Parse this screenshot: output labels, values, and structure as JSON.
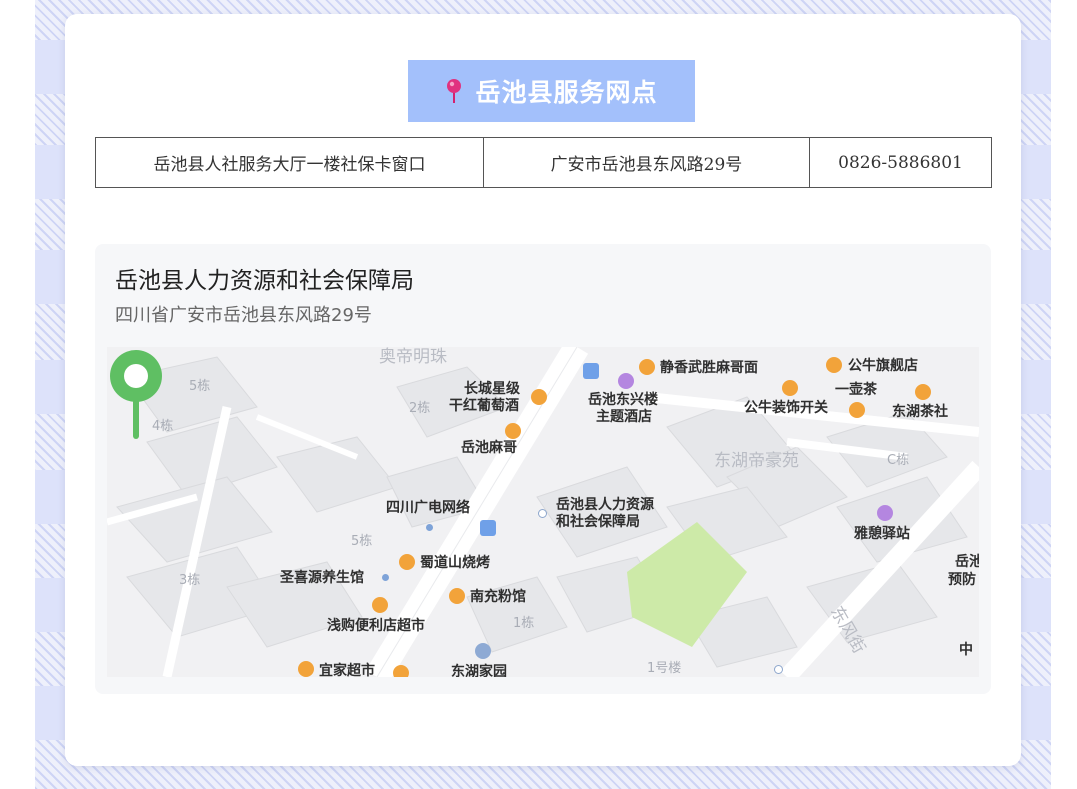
{
  "header": {
    "title": "岳池县服务网点",
    "title_icon": "map-pin-icon",
    "title_bg": "#a3c0fb"
  },
  "info_table": {
    "rows": [
      [
        "岳池县人社服务大厅一楼社保卡窗口",
        "广安市岳池县东风路29号",
        "0826-5886801"
      ]
    ]
  },
  "location": {
    "name": "岳池县人力资源和社会保障局",
    "address": "四川省广安市岳池县东风路29号"
  },
  "map": {
    "marker_color": "#5fbf63",
    "labels": {
      "aodi": "奥帝明珠",
      "b5": "5栋",
      "b4": "4栋",
      "b2": "2栋",
      "changcheng1": "长城星级",
      "changcheng2": "干红葡萄酒",
      "yuechi_mage": "岳池麻哥",
      "jingxiang": "静香武胜麻哥面",
      "dongxinglou1": "岳池东兴楼",
      "dongxinglou2": "主题酒店",
      "gongniu_flag": "公牛旗舰店",
      "yihucha": "一壶茶",
      "gongniu_deco": "公牛装饰开关",
      "donghu_tea": "东湖茶社",
      "donghu_dihao": "东湖帝豪苑",
      "cdong": "C栋",
      "sichuan_gd": "四川广电网络",
      "rs1": "岳池县人力资源",
      "rs2": "和社会保障局",
      "b5b": "5栋",
      "shudao": "蜀道山烧烤",
      "b3": "3栋",
      "shengxiyuan": "圣喜源养生馆",
      "nanchong": "南充粉馆",
      "qiangou": "浅购便利店超市",
      "b1": "1栋",
      "yaxi": "雅憩驿站",
      "yuechi_yf1": "岳池",
      "yuechi_yf2": "预防",
      "dongfeng": "东风街",
      "zhong": "中",
      "yijia": "宜家超市",
      "donghujiayuan": "东湖家园",
      "lou1": "1号楼"
    }
  }
}
